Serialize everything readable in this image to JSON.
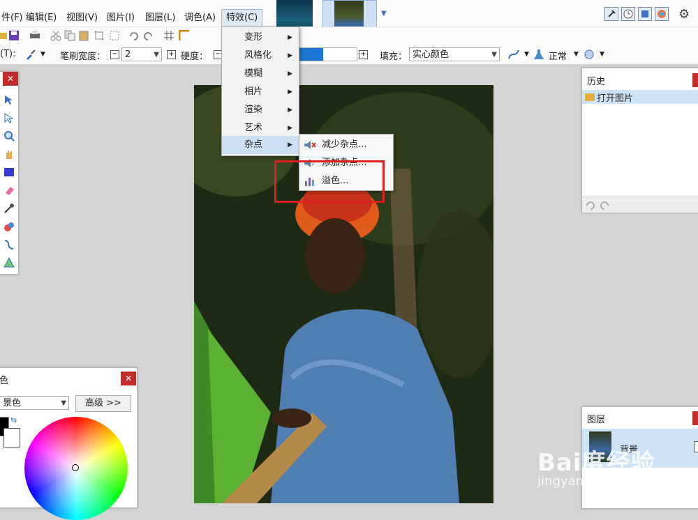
{
  "menubar": {
    "items": [
      "件(F)",
      "编辑(E)",
      "视图(V)",
      "图片(I)",
      "图层(L)",
      "调色(A)",
      "特效(C)"
    ]
  },
  "toolbar2": {
    "tool_label": "(T):",
    "brush_width_label": "笔刷宽度：",
    "brush_width_value": "2",
    "hardness_label": "硬度：",
    "fill_label": "填充：",
    "fill_value": "实心颜色",
    "blend_mode": "正常"
  },
  "effects_menu": {
    "items": [
      "变形",
      "风格化",
      "模糊",
      "相片",
      "渲染",
      "艺术",
      "杂点"
    ]
  },
  "noise_submenu": {
    "items": [
      "减少杂点...",
      "添加杂点...",
      "溢色..."
    ]
  },
  "history_panel": {
    "title": "历史",
    "items": [
      "打开图片"
    ]
  },
  "layers_panel": {
    "title": "图层",
    "layer_name": "背景"
  },
  "color_panel": {
    "title": "色",
    "select_value": "景色",
    "advanced_button": "高级 >>"
  },
  "watermark": {
    "brand": "Bai度经验",
    "url": "jingyan.baidu.com"
  },
  "colors": {
    "accent": "#cddff3",
    "highlight": "#e02020",
    "close": "#c42b2b"
  }
}
